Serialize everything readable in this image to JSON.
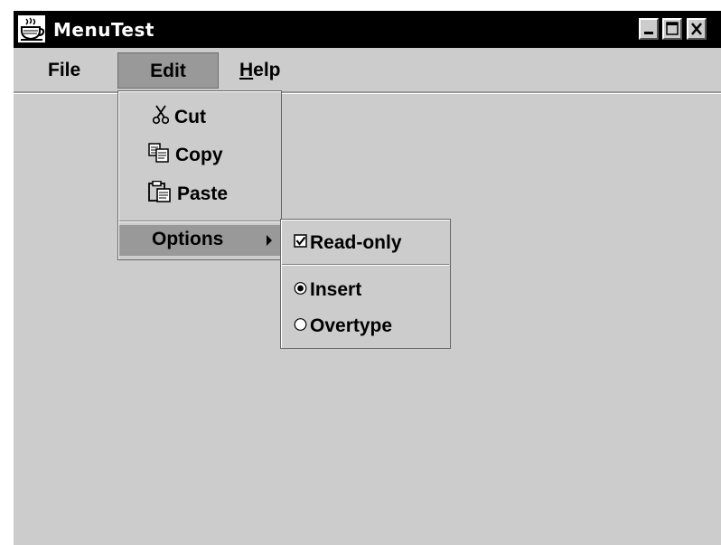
{
  "window": {
    "title": "MenuTest",
    "controls": [
      "minimize",
      "maximize",
      "close"
    ]
  },
  "menubar": {
    "file_label": "File",
    "edit_label": "Edit",
    "help_label": "Help",
    "help_mnemonic": "H",
    "help_rest": "elp",
    "active_menu": "Edit"
  },
  "edit_menu": {
    "cut_label": "Cut",
    "cut_icon": "scissors-icon",
    "copy_label": "Copy",
    "copy_icon": "copy-icon",
    "paste_label": "Paste",
    "paste_icon": "clipboard-icon",
    "options_label": "Options",
    "options_icon": "submenu-arrow-icon"
  },
  "options_menu": {
    "readonly_label": "Read-only",
    "readonly_checked": true,
    "insert_label": "Insert",
    "insert_selected": true,
    "overtype_label": "Overtype",
    "overtype_selected": false
  },
  "colors": {
    "background": "#cccccc",
    "highlight": "#999999",
    "titlebar": "#000000"
  }
}
